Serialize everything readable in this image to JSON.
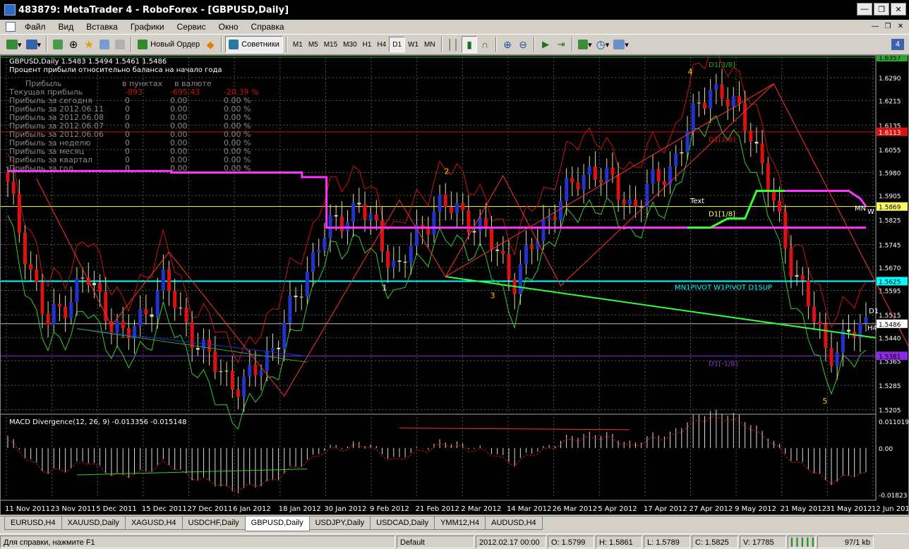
{
  "window": {
    "title": "483879: MetaTrader 4 - RoboForex - [GBPUSD,Daily]"
  },
  "menu": [
    "Файл",
    "Вид",
    "Вставка",
    "Графики",
    "Сервис",
    "Окно",
    "Справка"
  ],
  "toolbar": {
    "new_order": "Новый Ордер",
    "advisors": "Советники",
    "timeframes": [
      "M1",
      "M5",
      "M15",
      "M30",
      "H1",
      "H4",
      "D1",
      "W1",
      "MN"
    ],
    "active_timeframe": "D1",
    "badge": "4"
  },
  "chart": {
    "header": "GBPUSD,Daily  1.5483 1.5494 1.5461 1.5486",
    "subheader": "Процент прибыли относительно баланса на начало года",
    "profit_table": {
      "headers": [
        "Прибыль",
        "в пунктах",
        "в валюте"
      ],
      "rows": [
        {
          "label": "Текущая прибыль",
          "points": "-893",
          "money": "-695.43",
          "pct": "-20.39 %"
        },
        {
          "label": "Прибыль за сегодня",
          "points": "0",
          "money": "0.00",
          "pct": "0.00 %"
        },
        {
          "label": "Прибыль за 2012.06.11",
          "points": "0",
          "money": "0.00",
          "pct": "0.00 %"
        },
        {
          "label": "Прибыль за 2012.06.08",
          "points": "0",
          "money": "0.00",
          "pct": "0.00 %"
        },
        {
          "label": "Прибыль за 2012.06.07",
          "points": "0",
          "money": "0.00",
          "pct": "0.00 %"
        },
        {
          "label": "Прибыль за 2012.06.06",
          "points": "0",
          "money": "0.00",
          "pct": "0.00 %"
        },
        {
          "label": "Прибыль за неделю",
          "points": "0",
          "money": "0.00",
          "pct": "0.00 %"
        },
        {
          "label": "Прибыль за месяц",
          "points": "0",
          "money": "0.00",
          "pct": "0.00 %"
        },
        {
          "label": "Прибыль за квартал",
          "points": "0",
          "money": "0.00",
          "pct": "0.00 %"
        },
        {
          "label": "Прибыль за год",
          "points": "0",
          "money": "0.00",
          "pct": "0.00 %"
        }
      ]
    },
    "price_axis": [
      "1.6290",
      "1.6215",
      "1.6135",
      "1.6055",
      "1.5980",
      "1.5905",
      "1.5825",
      "1.5745",
      "1.5670",
      "1.5595",
      "1.5515",
      "1.5440",
      "1.5365",
      "1.5285",
      "1.5205"
    ],
    "price_range": [
      1.5195,
      1.6357
    ],
    "price_tags": [
      {
        "text": "1.6357",
        "value": 1.6357,
        "bg": "#22aa22",
        "fg": "#000000"
      },
      {
        "text": "1.6113",
        "value": 1.6113,
        "bg": "#dd1111",
        "fg": "#ffffff"
      },
      {
        "text": "1.5869",
        "value": 1.5869,
        "bg": "#ffff66",
        "fg": "#000000"
      },
      {
        "text": "1.5625",
        "value": 1.5625,
        "bg": "#00ffff",
        "fg": "#000000"
      },
      {
        "text": "1.5486",
        "value": 1.5486,
        "bg": "#ffffff",
        "fg": "#000000"
      },
      {
        "text": "1.5381",
        "value": 1.5381,
        "bg": "#8a2be2",
        "fg": "#000000"
      }
    ],
    "levels": [
      {
        "value": 1.6357,
        "color": "#22aa22"
      },
      {
        "value": 1.6113,
        "color": "#cc1111"
      },
      {
        "value": 1.5869,
        "color": "#ffff55"
      },
      {
        "value": 1.5625,
        "color": "#00ffff"
      },
      {
        "value": 1.5486,
        "color": "#bbbbbb"
      },
      {
        "value": 1.5381,
        "color": "#8a2be2"
      }
    ],
    "murrey_labels": [
      {
        "text": "D1[3/8]",
        "color": "#22aa22",
        "value": 1.6357
      },
      {
        "text": "D1[2/8]",
        "color": "#cc1111",
        "value": 1.6113
      },
      {
        "text": "D1[1/8]",
        "color": "#ffff55",
        "value": 1.5869
      },
      {
        "text": "MN1PIVOT W1PIVOT D1SUP",
        "color": "#00ffff",
        "value": 1.5625
      },
      {
        "text": "D1[-1/8]",
        "color": "#8a2be2",
        "value": 1.5381
      }
    ],
    "text_label": "Text",
    "side_labels": {
      "d1": "D1",
      "h4": "H4",
      "mn": "MN",
      "w": "W"
    },
    "wave_labels": [
      {
        "text": "1",
        "color": "#ffffff"
      },
      {
        "text": "2",
        "color": "#ffcc00"
      },
      {
        "text": "3",
        "color": "#ffcc00"
      },
      {
        "text": "4",
        "color": "#ffcc00"
      },
      {
        "text": "5",
        "color": "#ffcc00"
      }
    ],
    "date_axis": [
      "11 Nov 2011",
      "23 Nov 2011",
      "5 Dec 2011",
      "15 Dec 2011",
      "27 Dec 2011",
      "6 Jan 2012",
      "18 Jan 2012",
      "30 Jan 2012",
      "9 Feb 2012",
      "21 Feb 2012",
      "2 Mar 2012",
      "14 Mar 2012",
      "26 Mar 2012",
      "5 Apr 2012",
      "17 Apr 2012",
      "27 Apr 2012",
      "9 May 2012",
      "21 May 2012",
      "31 May 2012",
      "12 Jun 2012"
    ],
    "macd": {
      "label": "MACD Divergence(12, 26, 9) -0.013356 -0.015148",
      "axis": [
        "0.011019",
        "0.00",
        "-0.01823"
      ],
      "range": [
        -0.01823,
        0.011019
      ]
    },
    "colors": {
      "bull": "#2233cc",
      "bear": "#dd1111",
      "doji": "#ddddaa",
      "grid": "#555555",
      "magenta": "#ff33ff",
      "green": "#33ff33"
    }
  },
  "chart_data": {
    "type": "candlestick",
    "symbol": "GBPUSD",
    "timeframe": "Daily",
    "ylim": [
      1.5195,
      1.6357
    ],
    "key_points": [
      {
        "date": "11 Nov 2011",
        "close": 1.593
      },
      {
        "date": "23 Nov 2011",
        "close": 1.548
      },
      {
        "date": "5 Dec 2011",
        "close": 1.564
      },
      {
        "date": "15 Dec 2011",
        "close": 1.543
      },
      {
        "date": "27 Dec 2011",
        "close": 1.562
      },
      {
        "date": "6 Jan 2012",
        "close": 1.539
      },
      {
        "date": "11 Jan 2012",
        "close": 1.527
      },
      {
        "date": "18 Jan 2012",
        "close": 1.545
      },
      {
        "date": "30 Jan 2012",
        "close": 1.576
      },
      {
        "date": "6 Feb 2012",
        "close": 1.588
      },
      {
        "date": "15 Feb 2012",
        "close": 1.566
      },
      {
        "date": "27 Feb 2012",
        "close": 1.588
      },
      {
        "date": "2 Mar 2012",
        "close": 1.582
      },
      {
        "date": "9 Mar 2012",
        "close": 1.563
      },
      {
        "date": "19 Mar 2012",
        "close": 1.587
      },
      {
        "date": "28 Mar 2012",
        "close": 1.6
      },
      {
        "date": "5 Apr 2012",
        "close": 1.587
      },
      {
        "date": "17 Apr 2012",
        "close": 1.6
      },
      {
        "date": "27 Apr 2012",
        "close": 1.627
      },
      {
        "date": "9 May 2012",
        "close": 1.614
      },
      {
        "date": "21 May 2012",
        "close": 1.572
      },
      {
        "date": "31 May 2012",
        "close": 1.539
      },
      {
        "date": "12 Jun 2012",
        "close": 1.5486
      }
    ]
  },
  "tabs": [
    "EURUSD,H4",
    "XAUUSD,Daily",
    "XAGUSD,H4",
    "USDCHF,Daily",
    "GBPUSD,Daily",
    "USDJPY,Daily",
    "USDCAD,Daily",
    "YMM12,H4",
    "AUDUSD,H4"
  ],
  "active_tab": "GBPUSD,Daily",
  "status": {
    "help": "Для справки, нажмите F1",
    "profile": "Default",
    "datetime": "2012.02.17 00:00",
    "open": "O: 1.5799",
    "high": "H: 1.5861",
    "low": "L: 1.5789",
    "close": "C: 1.5825",
    "volume": "V: 17785",
    "traffic": "97/1 kb"
  }
}
